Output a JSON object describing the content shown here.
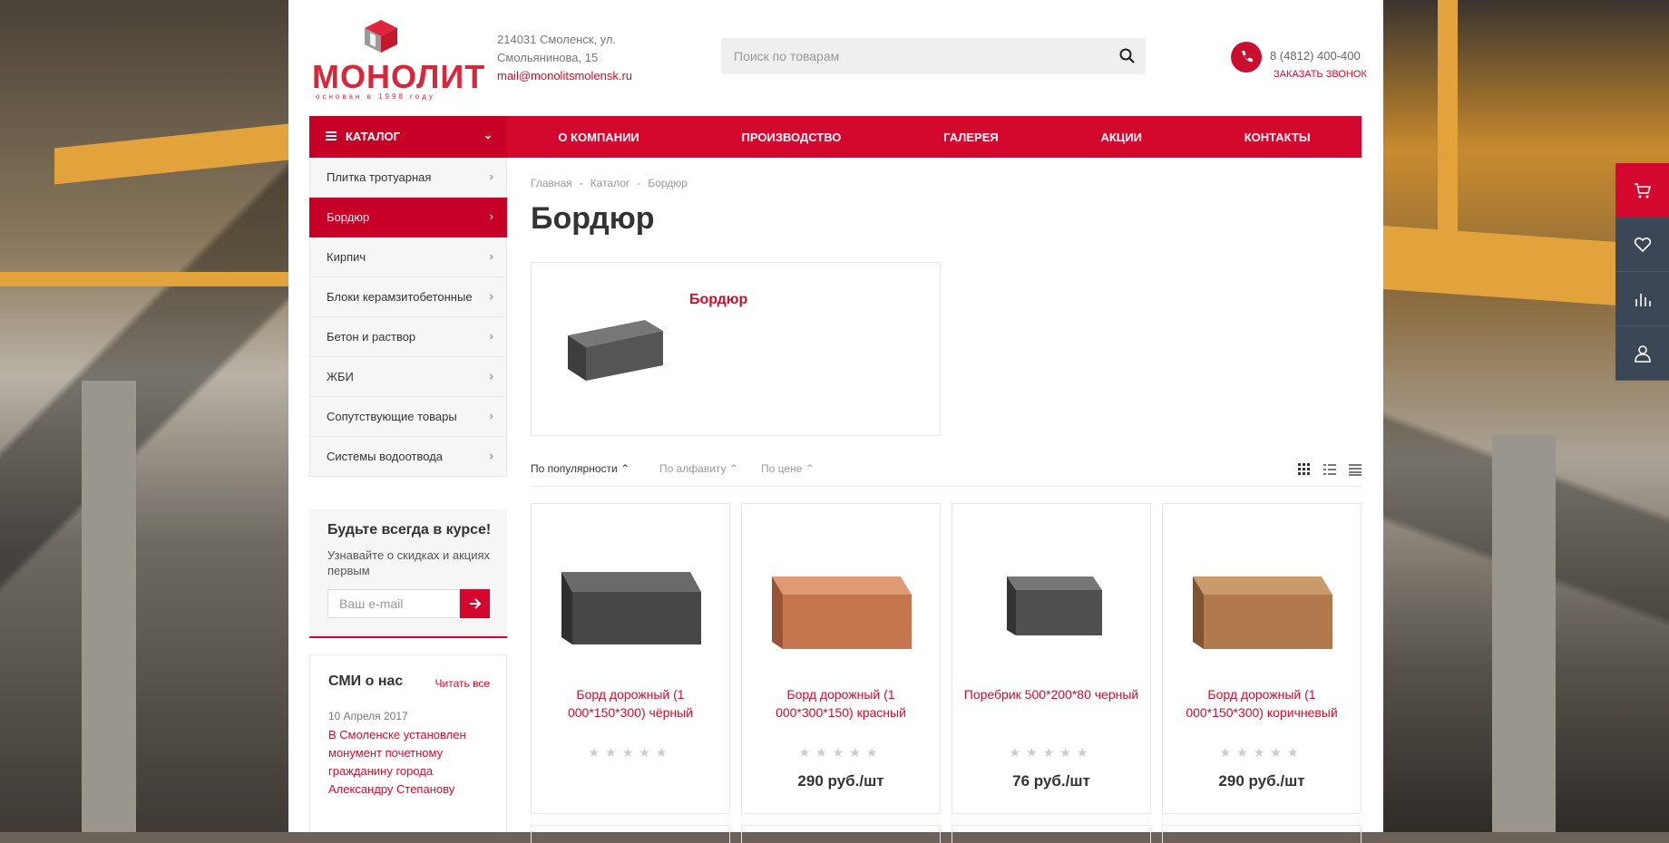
{
  "header": {
    "logo_text": "МОНОЛИТ",
    "logo_slogan": "основан в 1998 году",
    "address_line1": "214031 Смоленск, ул.",
    "address_line2": "Смольянинова, 15",
    "email": "mail@monolitsmolensk.ru",
    "search_placeholder": "Поиск по товарам",
    "phone": "8 (4812) 400-400",
    "callback": "ЗАКАЗАТЬ ЗВОНОК"
  },
  "nav": {
    "catalog": "КАТАЛОГ",
    "items": [
      "О КОМПАНИИ",
      "ПРОИЗВОДСТВО",
      "ГАЛЕРЕЯ",
      "АКЦИИ",
      "КОНТАКТЫ"
    ]
  },
  "sidebar": {
    "items": [
      {
        "label": "Плитка тротуарная",
        "active": false
      },
      {
        "label": "Бордюр",
        "active": true
      },
      {
        "label": "Кирпич",
        "active": false
      },
      {
        "label": "Блоки керамзитобетонные",
        "active": false
      },
      {
        "label": "Бетон и раствор",
        "active": false
      },
      {
        "label": "ЖБИ",
        "active": false
      },
      {
        "label": "Сопутствующие товары",
        "active": false
      },
      {
        "label": "Системы водоотвода",
        "active": false
      }
    ]
  },
  "subscribe": {
    "title": "Будьте всегда в курсе!",
    "text": "Узнавайте о скидках и акциях первым",
    "placeholder": "Ваш e-mail"
  },
  "media": {
    "title": "СМИ о нас",
    "read_all": "Читать все",
    "date": "10 Апреля 2017",
    "news": "В Смоленске установлен монумент почетному гражданину города Александру Степанову"
  },
  "main": {
    "breadcrumb": [
      "Главная",
      "Каталог",
      "Бордюр"
    ],
    "title": "Бордюр",
    "section_name": "Бордюр",
    "sort": {
      "popularity": "По популярности",
      "alphabet": "По алфавиту",
      "price": "По цене"
    },
    "products": [
      {
        "name": "Борд дорожный (1 000*150*300) чёрный",
        "price": "",
        "color": "#474747"
      },
      {
        "name": "Борд дорожный (1 000*300*150) красный",
        "price": "290 руб./шт",
        "color": "#c4774d"
      },
      {
        "name": "Поребрик 500*200*80 черный",
        "price": "76 руб./шт",
        "color": "#505050"
      },
      {
        "name": "Борд дорожный (1 000*150*300) коричневый",
        "price": "290 руб./шт",
        "color": "#b27a4c"
      }
    ]
  },
  "colors": {
    "accent": "#d4072e",
    "panel": "#3b4657"
  },
  "icons": [
    "search-icon",
    "phone-icon",
    "menu-icon",
    "cart-icon",
    "heart-icon",
    "compare-icon",
    "user-icon",
    "grid-view-icon",
    "list-view-icon",
    "table-view-icon",
    "arrow-right-icon"
  ]
}
